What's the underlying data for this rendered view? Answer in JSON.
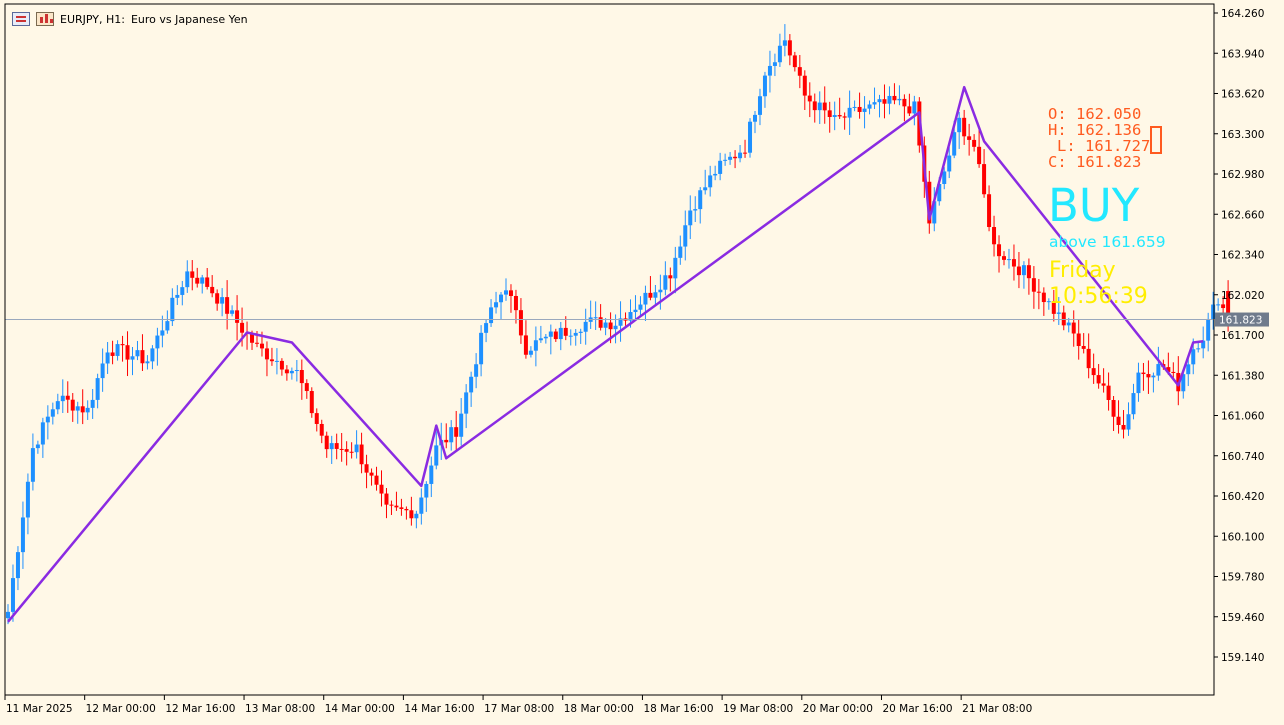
{
  "header": {
    "symbol": "EURJPY, H1:",
    "description": "Euro vs Japanese Yen"
  },
  "info_panel": {
    "open": "O: 162.050",
    "high": "H: 162.136",
    "low": "L: 161.727",
    "close": "C: 161.823",
    "signal": "BUY",
    "signal_detail": "above 161.659",
    "day": "Friday",
    "time": "10:56:39"
  },
  "colors": {
    "background": "#fff8e7",
    "bull": "#1e90ff",
    "bear": "#ff0000",
    "zigzag": "#8a2be2",
    "ohlc_text": "#ff5a1f",
    "signal_text": "#22e8ff",
    "clock_text": "#ffee00",
    "price_line": "#9aa8bd",
    "price_tag": "#707b8c"
  },
  "chart_data": {
    "type": "candlestick",
    "ylim": [
      158.9,
      164.3
    ],
    "y_ticks": [
      "164.260",
      "163.940",
      "163.620",
      "163.300",
      "162.980",
      "162.660",
      "162.340",
      "162.020",
      "161.700",
      "161.380",
      "161.060",
      "160.740",
      "160.420",
      "160.100",
      "159.780",
      "159.460",
      "159.140"
    ],
    "x_ticks": [
      "11 Mar 2025",
      "12 Mar 00:00",
      "12 Mar 16:00",
      "13 Mar 08:00",
      "14 Mar 00:00",
      "14 Mar 16:00",
      "17 Mar 08:00",
      "18 Mar 00:00",
      "18 Mar 16:00",
      "19 Mar 08:00",
      "20 Mar 00:00",
      "20 Mar 16:00",
      "21 Mar 08:00"
    ],
    "bars_per_tick": 16,
    "current_price": "161.823",
    "zigzag": [
      {
        "bar": 0,
        "price": 159.42
      },
      {
        "bar": 48,
        "price": 161.72
      },
      {
        "bar": 57,
        "price": 161.64
      },
      {
        "bar": 83,
        "price": 160.5
      },
      {
        "bar": 86,
        "price": 160.98
      },
      {
        "bar": 88,
        "price": 160.72
      },
      {
        "bar": 183,
        "price": 163.47
      },
      {
        "bar": 185,
        "price": 162.62
      },
      {
        "bar": 192,
        "price": 163.67
      },
      {
        "bar": 196,
        "price": 163.24
      },
      {
        "bar": 235,
        "price": 161.3
      },
      {
        "bar": 238,
        "price": 161.64
      },
      {
        "bar": 240,
        "price": 161.65
      }
    ],
    "anchors": [
      [
        0,
        159.5
      ],
      [
        5,
        160.8
      ],
      [
        10,
        161.2
      ],
      [
        16,
        161.1
      ],
      [
        20,
        161.6
      ],
      [
        28,
        161.5
      ],
      [
        36,
        162.2
      ],
      [
        40,
        162.1
      ],
      [
        46,
        161.8
      ],
      [
        50,
        161.6
      ],
      [
        58,
        161.4
      ],
      [
        64,
        160.8
      ],
      [
        70,
        160.8
      ],
      [
        76,
        160.3
      ],
      [
        82,
        160.3
      ],
      [
        86,
        160.8
      ],
      [
        90,
        160.95
      ],
      [
        96,
        161.8
      ],
      [
        100,
        162.1
      ],
      [
        104,
        161.6
      ],
      [
        110,
        161.7
      ],
      [
        116,
        161.8
      ],
      [
        122,
        161.8
      ],
      [
        128,
        162.0
      ],
      [
        133,
        162.2
      ],
      [
        137,
        162.7
      ],
      [
        142,
        163.0
      ],
      [
        148,
        163.2
      ],
      [
        152,
        163.8
      ],
      [
        156,
        164.05
      ],
      [
        160,
        163.6
      ],
      [
        166,
        163.4
      ],
      [
        172,
        163.5
      ],
      [
        178,
        163.55
      ],
      [
        182,
        163.5
      ],
      [
        185,
        162.6
      ],
      [
        188,
        163.0
      ],
      [
        191,
        163.4
      ],
      [
        194,
        163.2
      ],
      [
        198,
        162.4
      ],
      [
        204,
        162.2
      ],
      [
        210,
        161.9
      ],
      [
        214,
        161.7
      ],
      [
        218,
        161.4
      ],
      [
        222,
        161.1
      ],
      [
        224,
        160.95
      ],
      [
        227,
        161.4
      ],
      [
        232,
        161.45
      ],
      [
        235,
        161.3
      ],
      [
        238,
        161.6
      ],
      [
        240,
        161.7
      ],
      [
        243,
        162.0
      ],
      [
        245,
        161.82
      ]
    ]
  }
}
